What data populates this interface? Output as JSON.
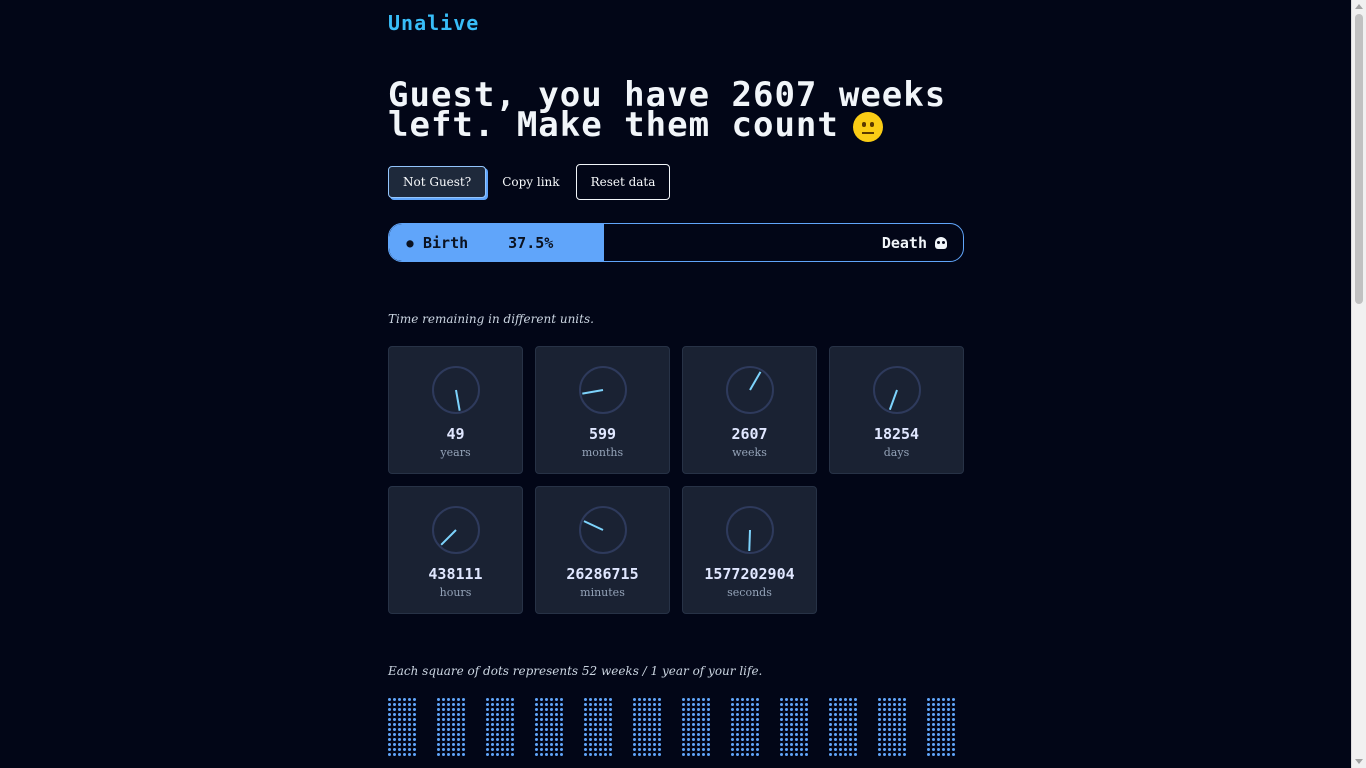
{
  "header": {
    "logo": "Unalive"
  },
  "headline": {
    "text": "Guest, you have 2607 weeks left. Make them count",
    "emoji": "smiling-face-icon"
  },
  "actions": {
    "not_guest": "Not Guest?",
    "copy_link": "Copy link",
    "reset_data": "Reset data"
  },
  "progress": {
    "start_label": "Birth",
    "percent_label": "37.5%",
    "percent_value": 37.5,
    "end_label": "Death",
    "start_icon": "baby-icon",
    "end_icon": "skull-icon"
  },
  "units_caption": "Time remaining in different units.",
  "units": [
    {
      "value": "49",
      "label": "years",
      "dial_angle": 170
    },
    {
      "value": "599",
      "label": "months",
      "dial_angle": 260
    },
    {
      "value": "2607",
      "label": "weeks",
      "dial_angle": 30
    },
    {
      "value": "18254",
      "label": "days",
      "dial_angle": 200
    },
    {
      "value": "438111",
      "label": "hours",
      "dial_angle": 225
    },
    {
      "value": "26286715",
      "label": "minutes",
      "dial_angle": 295
    },
    {
      "value": "1577202904",
      "label": "seconds",
      "dial_angle": 182
    }
  ],
  "grid_caption": "Each square of dots represents 52 weeks / 1 year of your life.",
  "colors": {
    "background": "#020617",
    "accent": "#60a5fa",
    "logo": "#38bdf8",
    "card": "#1a2233"
  }
}
